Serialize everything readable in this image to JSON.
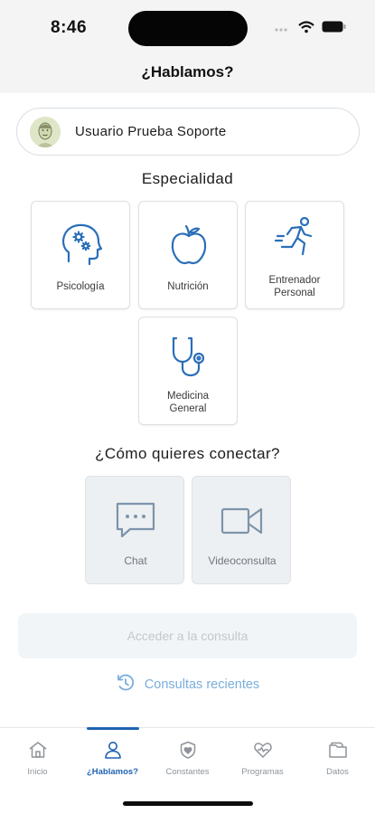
{
  "status_bar": {
    "time": "8:46"
  },
  "header": {
    "title": "¿Hablamos?"
  },
  "user": {
    "name": "Usuario Prueba Soporte"
  },
  "specialty": {
    "title": "Especialidad",
    "items": [
      {
        "label": "Psicología",
        "icon": "brain-head-icon"
      },
      {
        "label": "Nutrición",
        "icon": "apple-icon"
      },
      {
        "label_line1": "Entrenador",
        "label_line2": "Personal",
        "icon": "running-person-icon"
      },
      {
        "label_line1": "Medicina",
        "label_line2": "General",
        "icon": "stethoscope-icon"
      }
    ]
  },
  "connect": {
    "title": "¿Cómo quieres conectar?",
    "options": [
      {
        "label": "Chat",
        "icon": "chat-bubble-icon"
      },
      {
        "label": "Videoconsulta",
        "icon": "video-camera-icon"
      }
    ]
  },
  "access_button": {
    "label": "Acceder a la consulta"
  },
  "recent": {
    "label": "Consultas recientes",
    "icon": "history-icon"
  },
  "tabbar": {
    "items": [
      {
        "label": "Inicio",
        "icon": "home-icon"
      },
      {
        "label": "¿Hablamos?",
        "icon": "person-icon",
        "active": true
      },
      {
        "label": "Constantes",
        "icon": "heart-shield-icon"
      },
      {
        "label": "Programas",
        "icon": "heart-icon"
      },
      {
        "label": "Datos",
        "icon": "folder-icon"
      }
    ]
  },
  "colors": {
    "accent": "#1f63b2",
    "icon_blue": "#2a6fb8",
    "link_blue": "#7aaedc",
    "disabled_text": "#c2c8cd",
    "option_bg": "#edf0f2"
  }
}
